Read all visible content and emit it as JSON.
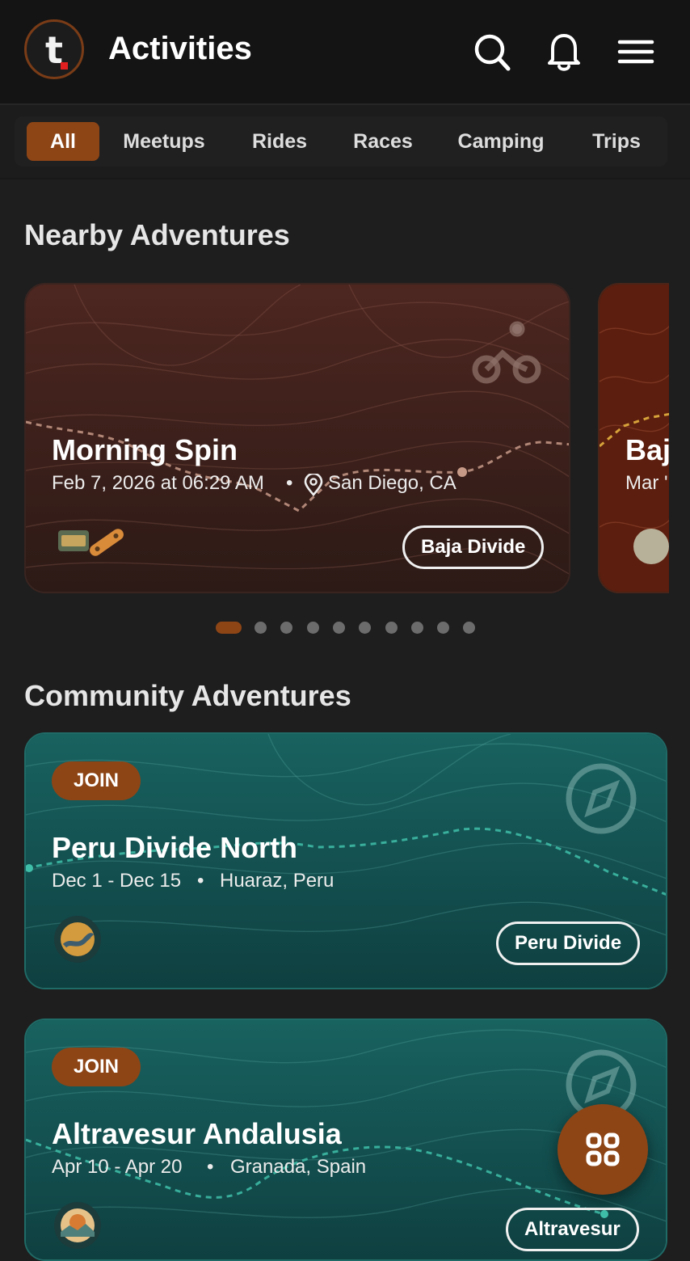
{
  "header": {
    "title": "Activities",
    "logo_letter": "t"
  },
  "tabs": [
    {
      "label": "All",
      "active": true
    },
    {
      "label": "Meetups",
      "active": false
    },
    {
      "label": "Rides",
      "active": false
    },
    {
      "label": "Races",
      "active": false
    },
    {
      "label": "Camping",
      "active": false
    },
    {
      "label": "Trips",
      "active": false
    }
  ],
  "nearby": {
    "title": "Nearby Adventures",
    "cards": [
      {
        "title": "Morning Spin",
        "date": "Feb 7, 2026 at 06:29 AM",
        "separator": "•",
        "location": "San Diego, CA",
        "group": "Baja Divide",
        "type_icon": "bicycle-icon"
      },
      {
        "title": "Baj",
        "date": "Mar '"
      }
    ],
    "pager": {
      "count": 10,
      "active_index": 0
    }
  },
  "community": {
    "title": "Community Adventures",
    "cards": [
      {
        "badge": "JOIN",
        "title": "Peru Divide North",
        "dates": "Dec 1 - Dec 15",
        "separator": "•",
        "location": "Huaraz, Peru",
        "group": "Peru Divide",
        "type_icon": "compass-icon"
      },
      {
        "badge": "JOIN",
        "title": "Altravesur Andalusia",
        "dates": "Apr 10 - Apr 20",
        "separator": "•",
        "location": "Granada, Spain",
        "group": "Altravesur",
        "type_icon": "compass-icon"
      }
    ]
  },
  "colors": {
    "accent": "#8e4516",
    "background": "#1e1e1e",
    "nearby_card": "#4a241c",
    "community_card": "#14595a"
  }
}
